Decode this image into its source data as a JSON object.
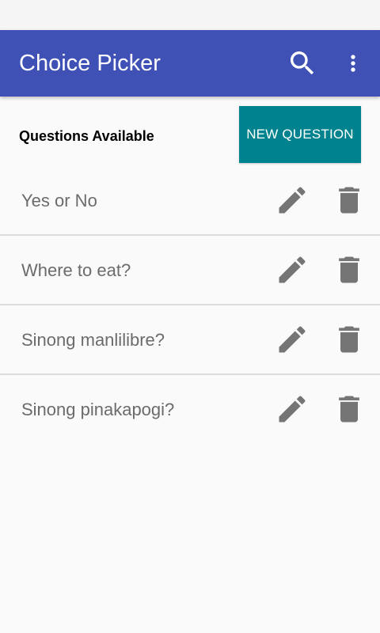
{
  "app_bar": {
    "title": "Choice Picker",
    "actions": [
      {
        "icon": "search-icon"
      },
      {
        "icon": "more-vert-icon"
      }
    ]
  },
  "section": {
    "title": "Questions Available",
    "new_question_label": "NEW QUESTION"
  },
  "questions": [
    {
      "text": "Yes or No"
    },
    {
      "text": "Where to eat?"
    },
    {
      "text": "Sinong manlilibre?"
    },
    {
      "text": "Sinong pinakapogi?"
    }
  ],
  "colors": {
    "app_bar": "#3f51b5",
    "accent_button": "#00838f",
    "row_text": "#6b6b6b",
    "icon_gray": "#757575",
    "divider": "#dcdcdc"
  }
}
